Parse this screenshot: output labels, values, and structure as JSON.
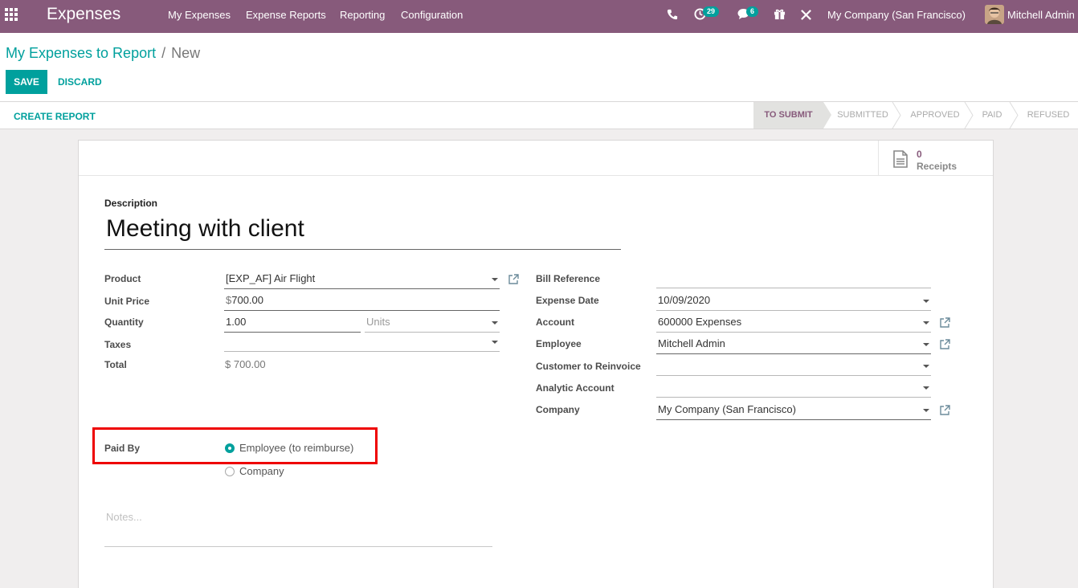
{
  "topbar": {
    "app_name": "Expenses",
    "menu": [
      "My Expenses",
      "Expense Reports",
      "Reporting",
      "Configuration"
    ],
    "activity_count": "29",
    "message_count": "6",
    "company": "My Company (San Francisco)",
    "user": "Mitchell Admin",
    "icons": [
      "apps-grid-icon",
      "phone-icon",
      "activity-clock-icon",
      "chat-icon",
      "gift-icon",
      "debug-tools-icon"
    ]
  },
  "control_panel": {
    "breadcrumb_parent": "My Expenses to Report",
    "breadcrumb_separator": "/",
    "breadcrumb_current": "New",
    "save_label": "SAVE",
    "discard_label": "DISCARD"
  },
  "statusbar": {
    "create_report_label": "CREATE REPORT",
    "stages": [
      "TO SUBMIT",
      "SUBMITTED",
      "APPROVED",
      "PAID",
      "REFUSED"
    ],
    "active_stage": "TO SUBMIT"
  },
  "button_box": {
    "receipts_count": "0",
    "receipts_label": "Receipts"
  },
  "form": {
    "description_label": "Description",
    "description_value": "Meeting with client",
    "left": {
      "product_label": "Product",
      "product_value": "[EXP_AF] Air Flight",
      "unit_price_label": "Unit Price",
      "unit_price_currency": "$",
      "unit_price_value": "700.00",
      "quantity_label": "Quantity",
      "quantity_value": "1.00",
      "uom_placeholder": "Units",
      "taxes_label": "Taxes",
      "taxes_value": "",
      "total_label": "Total",
      "total_value": "$ 700.00"
    },
    "right": {
      "bill_reference_label": "Bill Reference",
      "bill_reference_value": "",
      "expense_date_label": "Expense Date",
      "expense_date_value": "10/09/2020",
      "account_label": "Account",
      "account_value": "600000 Expenses",
      "employee_label": "Employee",
      "employee_value": "Mitchell Admin",
      "customer_reinvoice_label": "Customer to Reinvoice",
      "customer_reinvoice_value": "",
      "analytic_account_label": "Analytic Account",
      "analytic_account_value": "",
      "company_label": "Company",
      "company_value": "My Company (San Francisco)"
    },
    "paid_by_label": "Paid By",
    "paid_by_options": [
      "Employee (to reimburse)",
      "Company"
    ],
    "paid_by_selected": "Employee (to reimburse)",
    "notes_placeholder": "Notes..."
  },
  "colors": {
    "topbar": "#875a7b",
    "accent": "#00a09d",
    "highlight_box": "#e00000"
  }
}
